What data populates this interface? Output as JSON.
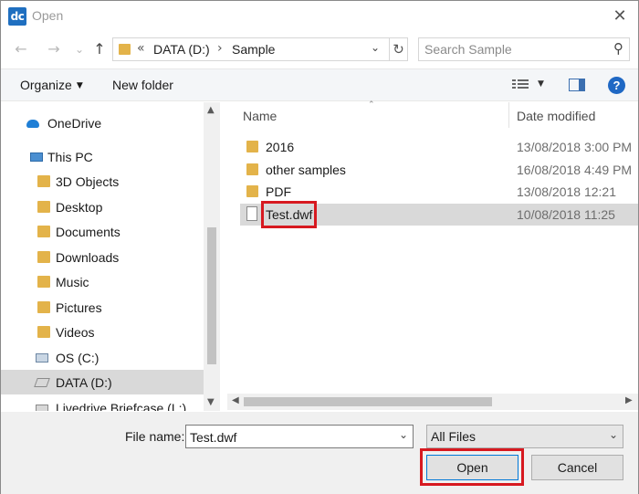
{
  "window": {
    "app_icon_text": "dc",
    "title": "Open",
    "close_glyph": "✕"
  },
  "navigation": {
    "back_glyph": "←",
    "forward_glyph": "→",
    "recent_glyph": "⌄",
    "up_glyph": "↑",
    "address_prefix": "«",
    "address_segments": [
      "DATA (D:)",
      "Sample"
    ],
    "address_separator": "›",
    "refresh_glyph": "↻",
    "search_placeholder": "Search Sample",
    "search_glyph": "⚲"
  },
  "toolbar": {
    "organize_label": "Organize",
    "new_folder_label": "New folder",
    "help_label": "?"
  },
  "nav_tree": {
    "items": [
      {
        "label": "OneDrive",
        "icon": "onedrive-icon"
      },
      {
        "label": "This PC",
        "icon": "pc-icon"
      },
      {
        "label": "3D Objects",
        "icon": "folder-icon"
      },
      {
        "label": "Desktop",
        "icon": "folder-icon"
      },
      {
        "label": "Documents",
        "icon": "folder-icon"
      },
      {
        "label": "Downloads",
        "icon": "folder-icon"
      },
      {
        "label": "Music",
        "icon": "folder-icon"
      },
      {
        "label": "Pictures",
        "icon": "folder-icon"
      },
      {
        "label": "Videos",
        "icon": "folder-icon"
      },
      {
        "label": "OS (C:)",
        "icon": "drive-icon"
      },
      {
        "label": "DATA (D:)",
        "icon": "drive-icon",
        "selected": true
      },
      {
        "label": "Livedrive Briefcase (L:)",
        "icon": "drive-icon"
      }
    ]
  },
  "file_list": {
    "columns": {
      "name": "Name",
      "date_modified": "Date modified"
    },
    "rows": [
      {
        "name": "2016",
        "date": "13/08/2018 3:00 PM",
        "type": "folder"
      },
      {
        "name": "other samples",
        "date": "16/08/2018 4:49 PM",
        "type": "folder"
      },
      {
        "name": "PDF",
        "date": "13/08/2018 12:21",
        "type": "folder"
      },
      {
        "name": "Test.dwf",
        "date": "10/08/2018 11:25",
        "type": "file",
        "selected": true
      }
    ]
  },
  "footer": {
    "file_name_label": "File name:",
    "file_name_value": "Test.dwf",
    "file_type_value": "All Files",
    "open_label": "Open",
    "cancel_label": "Cancel"
  },
  "colors": {
    "highlight_red": "#d71920",
    "selection_gray": "#d9d9d9",
    "folder_yellow": "#e3b34a",
    "help_blue": "#1f68c4"
  }
}
